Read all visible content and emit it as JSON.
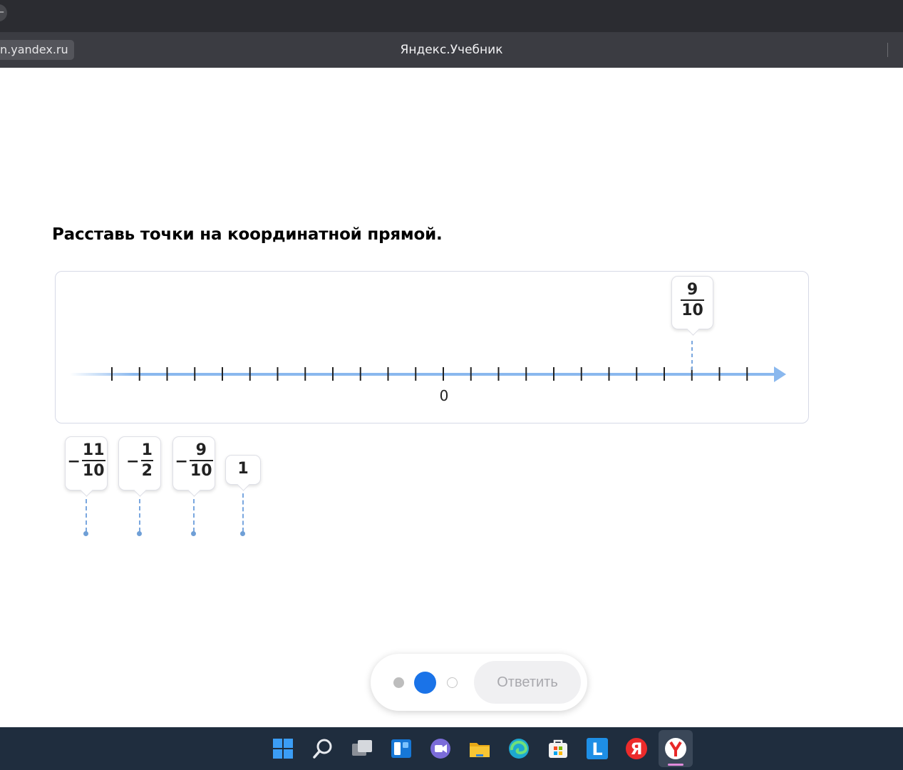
{
  "browser": {
    "back_glyph": "←",
    "url_fragment": "n.yandex.ru",
    "tab_title": "Яндекс.Учебник"
  },
  "task": {
    "title": "Расставь точки на координатной прямой."
  },
  "number_line": {
    "zero_label": "0",
    "tick_count": 24,
    "zero_tick_index": 12,
    "unit_ticks": 10,
    "axis_color": "#8ab8ee",
    "placed": [
      {
        "sign": "",
        "numerator": "9",
        "denominator": "10",
        "value": 0.9
      }
    ]
  },
  "bank": [
    {
      "id": "neg-11-10",
      "sign": "−",
      "numerator": "11",
      "denominator": "10",
      "value": -1.1
    },
    {
      "id": "neg-1-2",
      "sign": "−",
      "numerator": "1",
      "denominator": "2",
      "value": -0.5
    },
    {
      "id": "neg-9-10",
      "sign": "−",
      "numerator": "9",
      "denominator": "10",
      "value": -0.9
    },
    {
      "id": "one",
      "whole": "1",
      "value": 1
    }
  ],
  "controls": {
    "answer_label": "Ответить",
    "active_color": "#1a73e8",
    "current_step": 2,
    "steps_total": 3
  },
  "taskbar": {
    "icons": [
      "windows-start-icon",
      "search-icon",
      "task-view-icon",
      "widgets-icon",
      "chat-icon",
      "file-explorer-icon",
      "edge-icon",
      "store-icon",
      "l-app-icon",
      "yandex-icon",
      "yandex-browser-icon"
    ],
    "yandex_letter": "Я",
    "l_letter": "L"
  }
}
